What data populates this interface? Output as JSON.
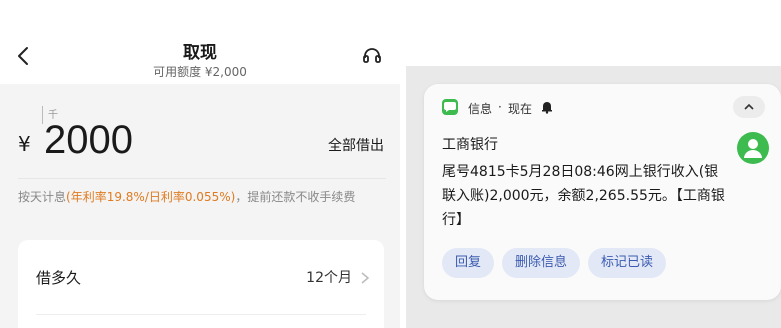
{
  "loan_screen": {
    "title": "取现",
    "subtitle": "可用额度 ¥2,000",
    "unit_hint": "千",
    "currency_symbol": "¥",
    "amount": "2000",
    "borrow_all_label": "全部借出",
    "interest_prefix": "按天计息",
    "interest_rate": "(年利率19.8%/日利率0.055%)",
    "interest_suffix": "，提前还款不收手续费",
    "term_label": "借多久",
    "term_value": "12个月",
    "icons": {
      "back": "back-arrow-icon",
      "support": "headset-icon",
      "term_chevron": "chevron-right-icon"
    }
  },
  "notification": {
    "app_name": "信息",
    "separator": "·",
    "time": "现在",
    "sender": "工商银行",
    "message": "尾号4815卡5月28日08:46网上银行收入(银联入账)2,000元，余额2,265.55元。【工商银行】",
    "actions": [
      "回复",
      "删除信息",
      "标记已读"
    ],
    "accent_color": "#3dbb4f",
    "icons": {
      "app": "message-app-icon",
      "bell": "bell-icon",
      "collapse": "chevron-up-icon",
      "avatar": "contact-avatar-icon"
    }
  }
}
